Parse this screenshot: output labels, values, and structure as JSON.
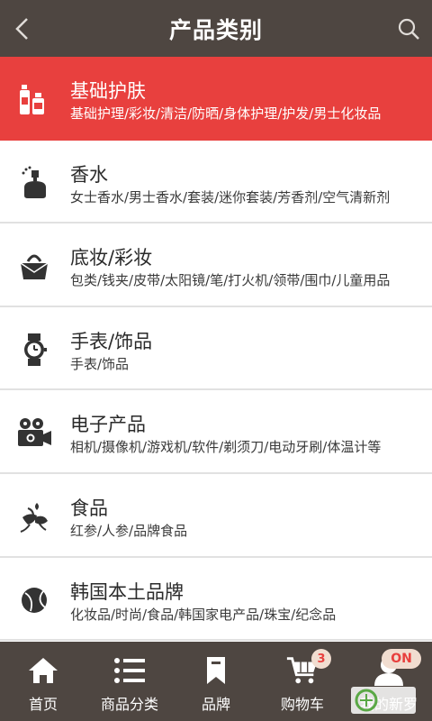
{
  "header": {
    "title": "产品类别",
    "back_icon": "chevron-left-icon",
    "search_icon": "search-icon"
  },
  "categories": [
    {
      "name": "基础护肤",
      "sub": "基础护理/彩妆/清洁/防晒/身体护理/护发/男士化妆品",
      "icon": "skincare-bottles-icon"
    },
    {
      "name": "香水",
      "sub": "女士香水/男士香水/套装/迷你套装/芳香剂/空气清新剂",
      "icon": "perfume-icon"
    },
    {
      "name": "底妆/彩妆",
      "sub": "包类/钱夹/皮带/太阳镜/笔/打火机/领带/围巾/儿童用品",
      "icon": "handbag-icon"
    },
    {
      "name": "手表/饰品",
      "sub": "手表/饰品",
      "icon": "watch-icon"
    },
    {
      "name": "电子产品",
      "sub": "相机/摄像机/游戏机/软件/剃须刀/电动牙刷/体温计等",
      "icon": "video-camera-icon"
    },
    {
      "name": "食品",
      "sub": "红参/人参/品牌食品",
      "icon": "ginseng-icon"
    },
    {
      "name": "韩国本土品牌",
      "sub": "化妆品/时尚/食品/韩国家电产品/珠宝/纪念品",
      "icon": "ball-icon"
    }
  ],
  "tabbar": {
    "home": {
      "label": "首页",
      "icon": "home-icon"
    },
    "category": {
      "label": "商品分类",
      "icon": "list-icon"
    },
    "brand": {
      "label": "品牌",
      "icon": "bookmark-icon"
    },
    "cart": {
      "label": "购物车",
      "icon": "cart-icon",
      "badge": "3"
    },
    "mine": {
      "label": "我的新罗",
      "icon": "user-icon",
      "badge": "ON"
    }
  },
  "colors": {
    "header_bg": "#4e4641",
    "accent": "#e8403e",
    "badge_bg": "#f1ddd0"
  }
}
